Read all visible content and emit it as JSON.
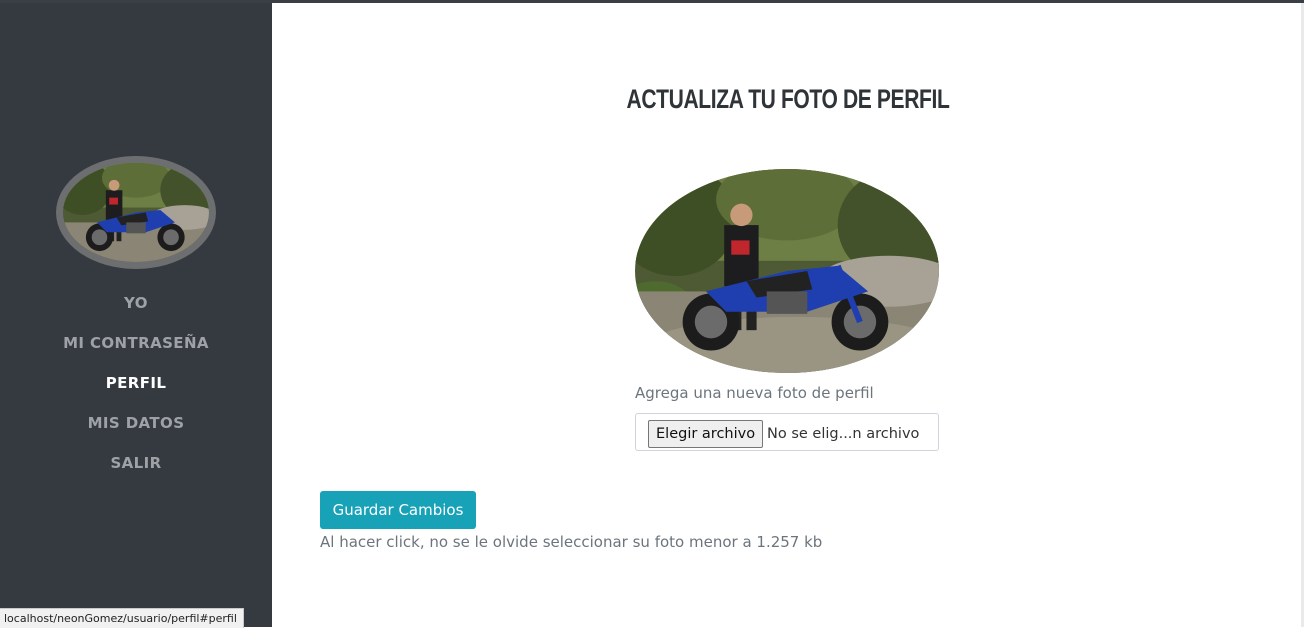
{
  "sidebar": {
    "avatar_alt": "profile-photo",
    "items": [
      {
        "label": "YO",
        "active": false
      },
      {
        "label": "MI CONTRASEÑA",
        "active": false
      },
      {
        "label": "PERFIL",
        "active": true
      },
      {
        "label": "MIS DATOS",
        "active": false
      },
      {
        "label": "SALIR",
        "active": false
      }
    ]
  },
  "status_bar": {
    "url": "localhost/neonGomez/usuario/perfil#perfil"
  },
  "main": {
    "title": "ACTUALIZA TU FOTO DE PERFIL",
    "upload_label": "Agrega una nueva foto de perfil",
    "file_input": {
      "button_label": "Elegir archivo",
      "status_text": "No se elig...n archivo"
    },
    "save_button_label": "Guardar Cambios",
    "help_text": "Al hacer click, no se le olvide seleccionar su foto menor a 1.257 kb"
  },
  "colors": {
    "sidebar_bg": "#343a40",
    "nav_inactive": "#9ea2a6",
    "nav_active": "#ffffff",
    "accent_button": "#17a2b8",
    "muted_text": "#6c757d",
    "title_text": "#2f3438"
  }
}
